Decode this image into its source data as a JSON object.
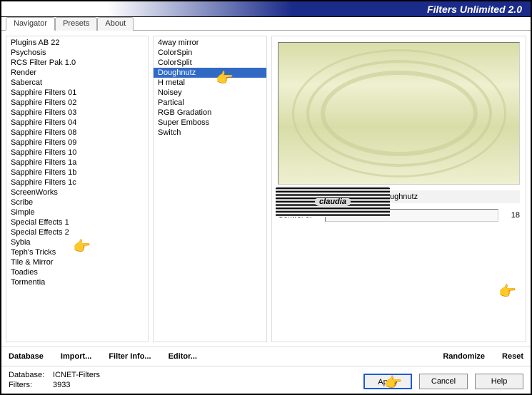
{
  "title": "Filters Unlimited 2.0",
  "tabs": [
    {
      "label": "Navigator",
      "active": true
    },
    {
      "label": "Presets",
      "active": false
    },
    {
      "label": "About",
      "active": false
    }
  ],
  "categories": [
    "Plugins AB 22",
    "Psychosis",
    "RCS Filter Pak 1.0",
    "Render",
    "Sabercat",
    "Sapphire Filters 01",
    "Sapphire Filters 02",
    "Sapphire Filters 03",
    "Sapphire Filters 04",
    "Sapphire Filters 08",
    "Sapphire Filters 09",
    "Sapphire Filters 10",
    "Sapphire Filters 1a",
    "Sapphire Filters 1b",
    "Sapphire Filters 1c",
    "ScreenWorks",
    "Scribe",
    "Simple",
    "Special Effects 1",
    "Special Effects 2",
    "Sybia",
    "Teph's Tricks",
    "Tile & Mirror",
    "Toadies",
    "Tormentia"
  ],
  "filters": [
    {
      "label": "4way mirror",
      "selected": false
    },
    {
      "label": "ColorSpin",
      "selected": false
    },
    {
      "label": "ColorSplit",
      "selected": false
    },
    {
      "label": "Doughnutz",
      "selected": true
    },
    {
      "label": "H metal",
      "selected": false
    },
    {
      "label": "Noisey",
      "selected": false
    },
    {
      "label": "Partical",
      "selected": false
    },
    {
      "label": "RGB Gradation",
      "selected": false
    },
    {
      "label": "Super Emboss",
      "selected": false
    },
    {
      "label": "Switch",
      "selected": false
    }
  ],
  "selected_filter_name": "Doughnutz",
  "controls": [
    {
      "label": "Control 0:",
      "value": "18"
    }
  ],
  "button_bar": {
    "database": "Database",
    "import": "Import...",
    "filter_info": "Filter Info...",
    "editor": "Editor...",
    "randomize": "Randomize",
    "reset": "Reset"
  },
  "status": {
    "db_label": "Database:",
    "db_value": "ICNET-Filters",
    "filters_label": "Filters:",
    "filters_value": "3933"
  },
  "bottom_buttons": {
    "apply": "Apply",
    "cancel": "Cancel",
    "help": "Help"
  },
  "watermark": "claudia",
  "icons": {
    "pointer": "👉"
  }
}
